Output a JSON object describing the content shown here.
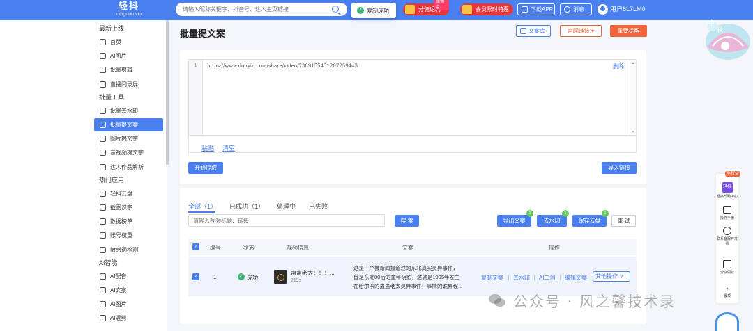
{
  "topbar": {
    "logo": "轻抖",
    "logo_sub": "qingdou.vip",
    "search_placeholder": "请输入昵称关键字、抖音号、达人主页链接",
    "toast": "复制成功",
    "promo1": "分佣返利",
    "promo1_tag": "赚佣金",
    "promo2": "会员限时特惠",
    "download": "下载APP",
    "messages": "消息",
    "user": "用户8L7LM0"
  },
  "sidebar": {
    "sections": [
      {
        "title": "最新上线",
        "items": [
          {
            "label": "首页",
            "icon": "checklist-icon"
          },
          {
            "label": "AI图片",
            "icon": "image-icon"
          },
          {
            "label": "批量剪辑",
            "icon": "scissors-icon"
          },
          {
            "label": "直播间录屏",
            "icon": "record-icon"
          }
        ]
      },
      {
        "title": "批量工具",
        "items": [
          {
            "label": "批量去水印",
            "icon": "watermark-icon"
          },
          {
            "label": "批量提文案",
            "icon": "document-icon",
            "active": true
          },
          {
            "label": "图片提文字",
            "icon": "image-text-icon"
          },
          {
            "label": "音视频提文字",
            "icon": "audio-icon"
          },
          {
            "label": "达人作品解析",
            "icon": "chart-icon"
          }
        ]
      },
      {
        "title": "热门应用",
        "items": [
          {
            "label": "轻抖云盘",
            "icon": "cloud-icon"
          },
          {
            "label": "截图识字",
            "icon": "screenshot-icon"
          },
          {
            "label": "数据榜单",
            "icon": "crown-icon"
          },
          {
            "label": "账号权重",
            "icon": "weight-icon"
          },
          {
            "label": "敏感词检测",
            "icon": "sensitive-icon"
          }
        ]
      },
      {
        "title": "AI智能",
        "items": [
          {
            "label": "AI配音",
            "icon": "voice-icon"
          },
          {
            "label": "AI文案",
            "icon": "text-icon"
          },
          {
            "label": "AI图片",
            "icon": "image-icon"
          },
          {
            "label": "AI混剪",
            "icon": "mix-icon"
          }
        ]
      }
    ]
  },
  "page": {
    "title": "批量提文案",
    "btn_library": "文案库",
    "btn_official": "官网链接",
    "btn_notice": "重要提醒"
  },
  "editor": {
    "line_no": "1",
    "content": "https://www.douyin.com/share/video/7389155431207259443",
    "delete": "删除",
    "paste": "粘贴",
    "clear": "清空",
    "start": "开始提取",
    "import": "导入链接"
  },
  "results": {
    "tabs": [
      "全部（1）",
      "已成功（1）",
      "处理中",
      "已失败"
    ],
    "filter_placeholder": "请输入视频标题、链接",
    "search": "搜 索",
    "export": "导出文案",
    "export_count": "1",
    "remove_wm": "去水印",
    "remove_wm_count": "1",
    "save_cloud": "保存云盘",
    "save_cloud_count": "1",
    "reset": "重 试",
    "columns": [
      "编号",
      "状态",
      "视频信息",
      "文案",
      "操作"
    ],
    "rows": [
      {
        "no": "1",
        "status": "成功",
        "video_title": "蛊蛊老太！！！...",
        "duration": "219s",
        "text_lines": [
          "这是一个被新闻报道过的东北真实灵异事件，",
          "曾是东北80后的童年阴影，这就是1995年发生",
          "在哈尔滨的蛊蛊老太灵异事件，事情的诡异程..."
        ],
        "actions": [
          "复制文案",
          "去水印",
          "AI二创",
          "编辑文案"
        ],
        "more": "其他操作"
      }
    ]
  },
  "float_toolbar": {
    "badge": "季权益",
    "items": [
      "轻抖帮助中心",
      "操作手册",
      "联系客服开发票",
      "分享同款",
      "置顶"
    ]
  },
  "watermark": "公众号 · 风之馨技术录"
}
